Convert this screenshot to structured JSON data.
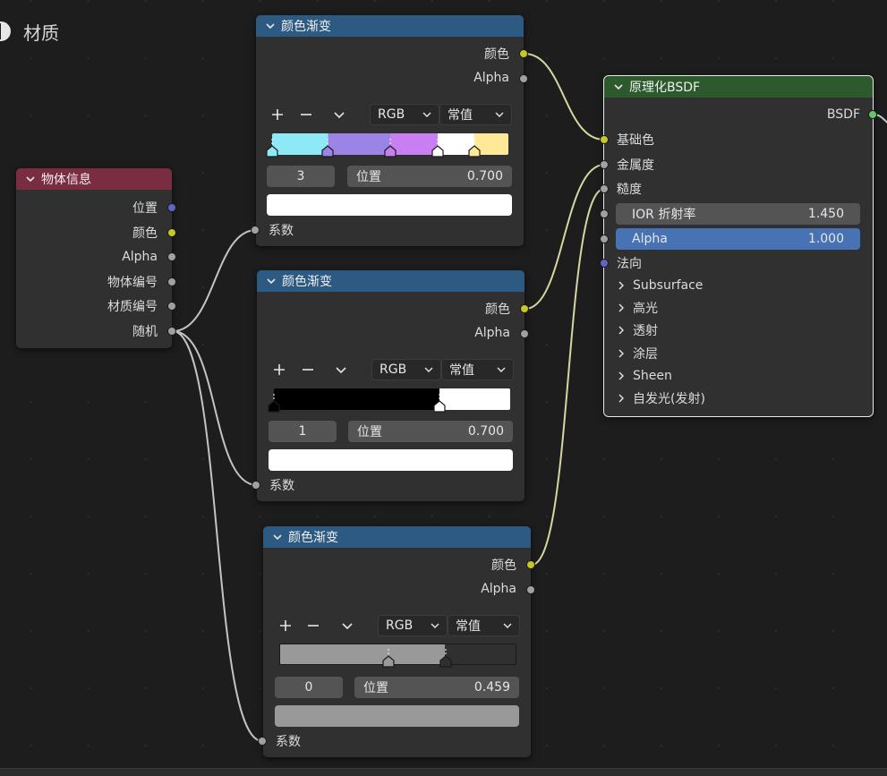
{
  "material_title": "材质",
  "ramp_nodes": [
    {
      "header": "颜色渐变",
      "out_color": "颜色",
      "out_alpha": "Alpha",
      "color_mode": "RGB",
      "interpolation": "常值",
      "stop_index": "3",
      "pos_label": "位置",
      "pos_value": "0.700",
      "in_fac": "系数",
      "swatch_color": "#ffffff",
      "stops": [
        {
          "pos": 0.0,
          "color": "#8ee9f7"
        },
        {
          "pos": 0.236,
          "color": "#9b84e6"
        },
        {
          "pos": 0.5,
          "color": "#c77ff2"
        },
        {
          "pos": 0.7,
          "color": "#ffffff"
        },
        {
          "pos": 0.855,
          "color": "#ffe999"
        }
      ]
    },
    {
      "header": "颜色渐变",
      "out_color": "颜色",
      "out_alpha": "Alpha",
      "color_mode": "RGB",
      "interpolation": "常值",
      "stop_index": "1",
      "pos_label": "位置",
      "pos_value": "0.700",
      "in_fac": "系数",
      "swatch_color": "#ffffff",
      "stops": [
        {
          "pos": 0.0,
          "color": "#000000"
        },
        {
          "pos": 0.7,
          "color": "#ffffff"
        }
      ]
    },
    {
      "header": "颜色渐变",
      "out_color": "颜色",
      "out_alpha": "Alpha",
      "color_mode": "RGB",
      "interpolation": "常值",
      "stop_index": "0",
      "pos_label": "位置",
      "pos_value": "0.459",
      "in_fac": "系数",
      "swatch_color": "#999999",
      "stops": [
        {
          "pos": 0.459,
          "color": "#999999"
        },
        {
          "pos": 0.7,
          "color": "#303030"
        }
      ]
    }
  ],
  "object_info": {
    "header": "物体信息",
    "outputs": [
      "位置",
      "颜色",
      "Alpha",
      "物体编号",
      "材质编号",
      "随机"
    ]
  },
  "bsdf": {
    "header": "原理化BSDF",
    "out_bsdf": "BSDF",
    "in_base_color": "基础色",
    "in_metallic": "金属度",
    "in_roughness": "糙度",
    "ior_label": "IOR 折射率",
    "ior_value": "1.450",
    "alpha_label": "Alpha",
    "alpha_value": "1.000",
    "in_normal": "法向",
    "panels": [
      "Subsurface",
      "高光",
      "透射",
      "涂层",
      "Sheen",
      "自发光(发射)"
    ]
  },
  "colors": {
    "ramp_header": "#2c5a82",
    "input_header": "#7a2c42",
    "shader_header": "#2c5a2c",
    "socket_color": "#c7c729",
    "socket_float": "#a1a1a1",
    "socket_vector": "#6363c7",
    "socket_shader": "#63c763",
    "wire": "#c8c8c8",
    "wire_color": "#d6d6a0",
    "alpha_field": "#4772b3"
  }
}
